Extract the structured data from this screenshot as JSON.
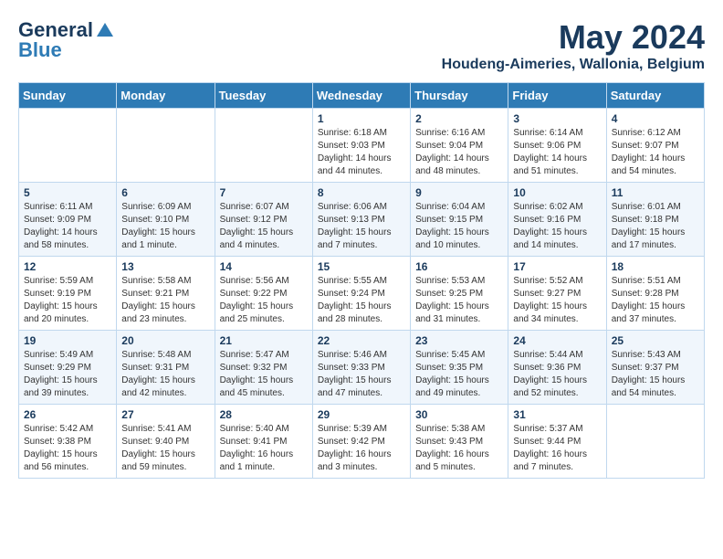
{
  "header": {
    "logo_general": "General",
    "logo_blue": "Blue",
    "month": "May 2024",
    "location": "Houdeng-Aimeries, Wallonia, Belgium"
  },
  "weekdays": [
    "Sunday",
    "Monday",
    "Tuesday",
    "Wednesday",
    "Thursday",
    "Friday",
    "Saturday"
  ],
  "weeks": [
    [
      {
        "day": "",
        "sunrise": "",
        "sunset": "",
        "daylight": ""
      },
      {
        "day": "",
        "sunrise": "",
        "sunset": "",
        "daylight": ""
      },
      {
        "day": "",
        "sunrise": "",
        "sunset": "",
        "daylight": ""
      },
      {
        "day": "1",
        "sunrise": "Sunrise: 6:18 AM",
        "sunset": "Sunset: 9:03 PM",
        "daylight": "Daylight: 14 hours and 44 minutes."
      },
      {
        "day": "2",
        "sunrise": "Sunrise: 6:16 AM",
        "sunset": "Sunset: 9:04 PM",
        "daylight": "Daylight: 14 hours and 48 minutes."
      },
      {
        "day": "3",
        "sunrise": "Sunrise: 6:14 AM",
        "sunset": "Sunset: 9:06 PM",
        "daylight": "Daylight: 14 hours and 51 minutes."
      },
      {
        "day": "4",
        "sunrise": "Sunrise: 6:12 AM",
        "sunset": "Sunset: 9:07 PM",
        "daylight": "Daylight: 14 hours and 54 minutes."
      }
    ],
    [
      {
        "day": "5",
        "sunrise": "Sunrise: 6:11 AM",
        "sunset": "Sunset: 9:09 PM",
        "daylight": "Daylight: 14 hours and 58 minutes."
      },
      {
        "day": "6",
        "sunrise": "Sunrise: 6:09 AM",
        "sunset": "Sunset: 9:10 PM",
        "daylight": "Daylight: 15 hours and 1 minute."
      },
      {
        "day": "7",
        "sunrise": "Sunrise: 6:07 AM",
        "sunset": "Sunset: 9:12 PM",
        "daylight": "Daylight: 15 hours and 4 minutes."
      },
      {
        "day": "8",
        "sunrise": "Sunrise: 6:06 AM",
        "sunset": "Sunset: 9:13 PM",
        "daylight": "Daylight: 15 hours and 7 minutes."
      },
      {
        "day": "9",
        "sunrise": "Sunrise: 6:04 AM",
        "sunset": "Sunset: 9:15 PM",
        "daylight": "Daylight: 15 hours and 10 minutes."
      },
      {
        "day": "10",
        "sunrise": "Sunrise: 6:02 AM",
        "sunset": "Sunset: 9:16 PM",
        "daylight": "Daylight: 15 hours and 14 minutes."
      },
      {
        "day": "11",
        "sunrise": "Sunrise: 6:01 AM",
        "sunset": "Sunset: 9:18 PM",
        "daylight": "Daylight: 15 hours and 17 minutes."
      }
    ],
    [
      {
        "day": "12",
        "sunrise": "Sunrise: 5:59 AM",
        "sunset": "Sunset: 9:19 PM",
        "daylight": "Daylight: 15 hours and 20 minutes."
      },
      {
        "day": "13",
        "sunrise": "Sunrise: 5:58 AM",
        "sunset": "Sunset: 9:21 PM",
        "daylight": "Daylight: 15 hours and 23 minutes."
      },
      {
        "day": "14",
        "sunrise": "Sunrise: 5:56 AM",
        "sunset": "Sunset: 9:22 PM",
        "daylight": "Daylight: 15 hours and 25 minutes."
      },
      {
        "day": "15",
        "sunrise": "Sunrise: 5:55 AM",
        "sunset": "Sunset: 9:24 PM",
        "daylight": "Daylight: 15 hours and 28 minutes."
      },
      {
        "day": "16",
        "sunrise": "Sunrise: 5:53 AM",
        "sunset": "Sunset: 9:25 PM",
        "daylight": "Daylight: 15 hours and 31 minutes."
      },
      {
        "day": "17",
        "sunrise": "Sunrise: 5:52 AM",
        "sunset": "Sunset: 9:27 PM",
        "daylight": "Daylight: 15 hours and 34 minutes."
      },
      {
        "day": "18",
        "sunrise": "Sunrise: 5:51 AM",
        "sunset": "Sunset: 9:28 PM",
        "daylight": "Daylight: 15 hours and 37 minutes."
      }
    ],
    [
      {
        "day": "19",
        "sunrise": "Sunrise: 5:49 AM",
        "sunset": "Sunset: 9:29 PM",
        "daylight": "Daylight: 15 hours and 39 minutes."
      },
      {
        "day": "20",
        "sunrise": "Sunrise: 5:48 AM",
        "sunset": "Sunset: 9:31 PM",
        "daylight": "Daylight: 15 hours and 42 minutes."
      },
      {
        "day": "21",
        "sunrise": "Sunrise: 5:47 AM",
        "sunset": "Sunset: 9:32 PM",
        "daylight": "Daylight: 15 hours and 45 minutes."
      },
      {
        "day": "22",
        "sunrise": "Sunrise: 5:46 AM",
        "sunset": "Sunset: 9:33 PM",
        "daylight": "Daylight: 15 hours and 47 minutes."
      },
      {
        "day": "23",
        "sunrise": "Sunrise: 5:45 AM",
        "sunset": "Sunset: 9:35 PM",
        "daylight": "Daylight: 15 hours and 49 minutes."
      },
      {
        "day": "24",
        "sunrise": "Sunrise: 5:44 AM",
        "sunset": "Sunset: 9:36 PM",
        "daylight": "Daylight: 15 hours and 52 minutes."
      },
      {
        "day": "25",
        "sunrise": "Sunrise: 5:43 AM",
        "sunset": "Sunset: 9:37 PM",
        "daylight": "Daylight: 15 hours and 54 minutes."
      }
    ],
    [
      {
        "day": "26",
        "sunrise": "Sunrise: 5:42 AM",
        "sunset": "Sunset: 9:38 PM",
        "daylight": "Daylight: 15 hours and 56 minutes."
      },
      {
        "day": "27",
        "sunrise": "Sunrise: 5:41 AM",
        "sunset": "Sunset: 9:40 PM",
        "daylight": "Daylight: 15 hours and 59 minutes."
      },
      {
        "day": "28",
        "sunrise": "Sunrise: 5:40 AM",
        "sunset": "Sunset: 9:41 PM",
        "daylight": "Daylight: 16 hours and 1 minute."
      },
      {
        "day": "29",
        "sunrise": "Sunrise: 5:39 AM",
        "sunset": "Sunset: 9:42 PM",
        "daylight": "Daylight: 16 hours and 3 minutes."
      },
      {
        "day": "30",
        "sunrise": "Sunrise: 5:38 AM",
        "sunset": "Sunset: 9:43 PM",
        "daylight": "Daylight: 16 hours and 5 minutes."
      },
      {
        "day": "31",
        "sunrise": "Sunrise: 5:37 AM",
        "sunset": "Sunset: 9:44 PM",
        "daylight": "Daylight: 16 hours and 7 minutes."
      },
      {
        "day": "",
        "sunrise": "",
        "sunset": "",
        "daylight": ""
      }
    ]
  ]
}
